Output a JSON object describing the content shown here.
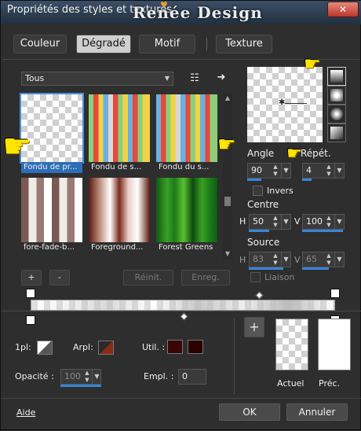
{
  "window": {
    "title": "Propriétés des styles et textures",
    "banner": "Renée Design",
    "close_label": "✕"
  },
  "tabs": [
    {
      "label": "Couleur",
      "active": false
    },
    {
      "label": "Dégradé",
      "active": true
    },
    {
      "label": "Motif",
      "active": false
    },
    {
      "label": "Texture",
      "active": false
    }
  ],
  "library": {
    "category": "Tous",
    "items": [
      {
        "label": "Fondu de pr...",
        "selected": true
      },
      {
        "label": "Fondu de s...",
        "selected": false
      },
      {
        "label": "Fondu du s...",
        "selected": false
      },
      {
        "label": "fore-fade-b...",
        "selected": false
      },
      {
        "label": "Foreground...",
        "selected": false
      },
      {
        "label": "Forest Greens",
        "selected": false
      }
    ],
    "add_label": "+",
    "remove_label": "-",
    "reset_label": "Réinit.",
    "save_label": "Enreg."
  },
  "settings": {
    "angle_label": "Angle",
    "angle_value": "90",
    "repeat_label": "Répét.",
    "repeat_value": "4",
    "invert_label": "Invers",
    "center_label": "Centre",
    "center_h_label": "H",
    "center_h_value": "50",
    "center_v_label": "V",
    "center_v_value": "100",
    "source_label": "Source",
    "source_h_label": "H",
    "source_h_value": "83",
    "source_v_label": "V",
    "source_v_value": "65",
    "link_label": "Liaison"
  },
  "stop_settings": {
    "onepl_label": "1pl:",
    "arpl_label": "Arpl:",
    "util_label": "Util. :",
    "opacity_label": "Opacité :",
    "opacity_value": "100",
    "empl_label": "Empl. :",
    "empl_value": "0"
  },
  "preview": {
    "add_label": "+",
    "current_label": "Actuel",
    "previous_label": "Préc."
  },
  "footer": {
    "help_label": "Aide",
    "ok_label": "OK",
    "cancel_label": "Annuler"
  },
  "colors": {
    "accent": "#2d6fb6",
    "swatch_dark_red": "#3a0606",
    "swatch_dark_red2": "#2a0202"
  }
}
